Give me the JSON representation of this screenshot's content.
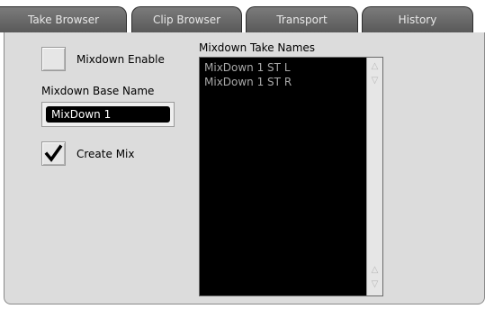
{
  "tabs": [
    {
      "label": "Take Browser"
    },
    {
      "label": "Clip Browser"
    },
    {
      "label": "Transport"
    },
    {
      "label": "History"
    }
  ],
  "mixdown_enable": {
    "label": "Mixdown Enable",
    "checked": false
  },
  "base_name": {
    "label": "Mixdown Base Name",
    "value": "MixDown 1"
  },
  "create_mix": {
    "label": "Create Mix",
    "checked": true
  },
  "take_names": {
    "label": "Mixdown Take Names",
    "items": [
      {
        "name": "MixDown 1 ST L"
      },
      {
        "name": "MixDown 1 ST R"
      }
    ]
  }
}
